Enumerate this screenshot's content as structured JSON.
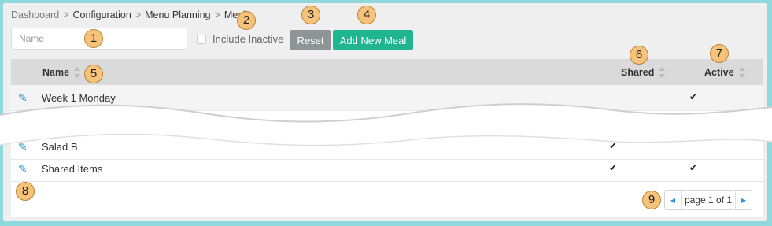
{
  "breadcrumb": {
    "items": [
      "Dashboard",
      "Configuration",
      "Menu Planning",
      "Meals"
    ],
    "separator": ">"
  },
  "filters": {
    "name_placeholder": "Name",
    "include_inactive_label": "Include Inactive",
    "reset_label": "Reset",
    "add_label": "Add New Meal"
  },
  "table": {
    "columns": {
      "name": "Name",
      "shared": "Shared",
      "active": "Active"
    },
    "rows": [
      {
        "name": "Week 1 Monday",
        "shared": "",
        "active": "✔"
      },
      {
        "name": "Salad B",
        "shared": "✔",
        "active": ""
      },
      {
        "name": "Shared Items",
        "shared": "✔",
        "active": "✔"
      }
    ]
  },
  "pagination": {
    "text": "page 1 of 1"
  },
  "callouts": [
    "1",
    "2",
    "3",
    "4",
    "5",
    "6",
    "7",
    "8",
    "9"
  ],
  "colors": {
    "accent": "#1fb58f",
    "reset": "#8f9497",
    "link": "#2a95d4",
    "callout": "#f7c37a"
  }
}
